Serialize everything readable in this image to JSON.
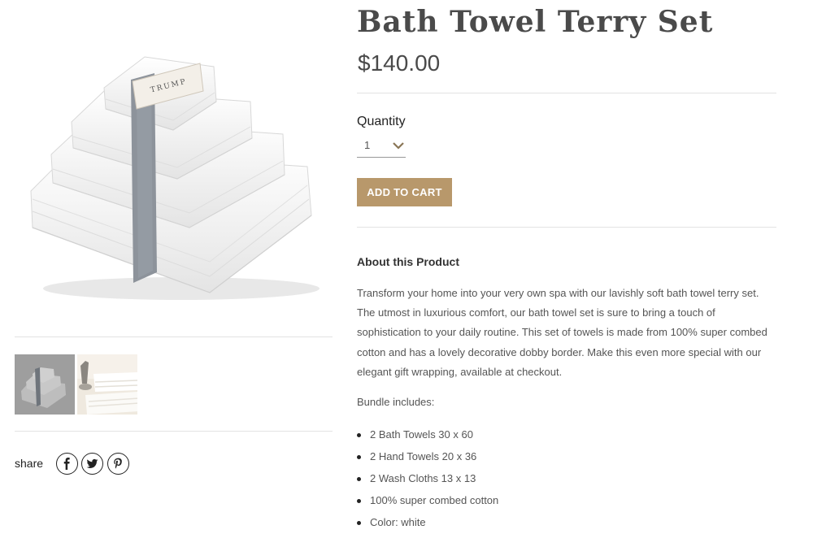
{
  "product": {
    "title": "Bath Towel Terry Set",
    "price": "$140.00",
    "band_text": "TRUMP",
    "quantity_label": "Quantity",
    "quantity_value": "1",
    "add_to_cart_label": "ADD TO CART"
  },
  "gallery": {
    "thumbnails": [
      {
        "name": "towel-set-thumbnail",
        "selected": true
      },
      {
        "name": "towel-lifestyle-thumbnail",
        "selected": false
      }
    ]
  },
  "share": {
    "label": "share",
    "icons": [
      "facebook-icon",
      "twitter-icon",
      "pinterest-icon"
    ]
  },
  "about": {
    "title": "About this Product",
    "description": "Transform your home into your very own spa with our lavishly soft bath towel terry set. The utmost in luxurious comfort, our bath towel set is sure to bring a touch of sophistication to your daily routine. This set of towels is made from 100% super combed cotton and has a lovely decorative dobby border. Make this even more special with our elegant gift wrapping, available at checkout.",
    "bundle_label": "Bundle includes:",
    "bundle_items": [
      "2 Bath Towels 30 x 60",
      "2 Hand Towels 20 x 36",
      "2 Wash Cloths 13 x 13",
      "100% super combed cotton",
      "Color: white"
    ]
  },
  "colors": {
    "accent": "#b8986b",
    "title": "#4a4a4a",
    "divider": "#e3e3e3"
  }
}
